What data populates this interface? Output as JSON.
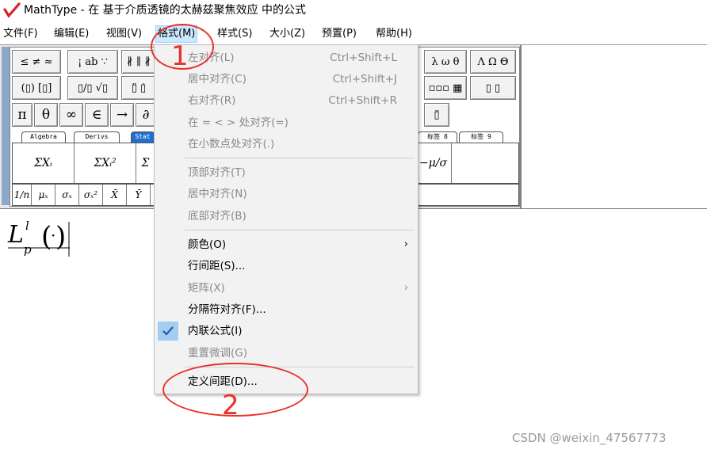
{
  "window": {
    "title": "MathType - 在 基于介质透镜的太赫兹聚焦效应 中的公式"
  },
  "menubar": {
    "items": [
      "文件(F)",
      "编辑(E)",
      "视图(V)",
      "格式(M)",
      "样式(S)",
      "大小(Z)",
      "预置(P)",
      "帮助(H)"
    ],
    "active": "格式(M)"
  },
  "toolbar": {
    "row1": [
      "≤ ≠ ≈",
      "¡ ab ∵",
      "∦ ∥ ∦",
      "λ ω θ",
      "Λ Ω Θ"
    ],
    "row2": [
      "(▯) [▯]",
      "▯/▯ √▯",
      "▯̈ ▯̇",
      "▫▫▫ ▦",
      "▯ ▯"
    ],
    "row3": [
      "π",
      "θ",
      "∞",
      "∈",
      "→",
      "∂",
      "▯̈"
    ],
    "tabs": [
      "Algebra",
      "Derivs",
      "Stat",
      "标签 8",
      "标签 9"
    ],
    "palette": [
      "ΣXᵢ",
      "ΣXᵢ²",
      "Σ",
      "−μ/σ"
    ],
    "small_row": [
      "1/n",
      "μₓ",
      "σₓ",
      "σₓ²",
      "X̄",
      "Ȳ"
    ]
  },
  "equation": {
    "text": "L_p^l(·)"
  },
  "format_menu": {
    "items": [
      {
        "label": "左对齐(L)",
        "shortcut": "Ctrl+Shift+L",
        "enabled": false
      },
      {
        "label": "居中对齐(C)",
        "shortcut": "Ctrl+Shift+J",
        "enabled": false
      },
      {
        "label": "右对齐(R)",
        "shortcut": "Ctrl+Shift+R",
        "enabled": false
      },
      {
        "label": "在 = < > 处对齐(=)",
        "shortcut": "",
        "enabled": false
      },
      {
        "label": "在小数点处对齐(.)",
        "shortcut": "",
        "enabled": false
      },
      {
        "label": "顶部对齐(T)",
        "shortcut": "",
        "enabled": false
      },
      {
        "label": "居中对齐(N)",
        "shortcut": "",
        "enabled": false
      },
      {
        "label": "底部对齐(B)",
        "shortcut": "",
        "enabled": false
      },
      {
        "label": "颜色(O)",
        "shortcut": "",
        "enabled": true,
        "submenu": true
      },
      {
        "label": "行间距(S)...",
        "shortcut": "",
        "enabled": true
      },
      {
        "label": "矩阵(X)",
        "shortcut": "",
        "enabled": false,
        "submenu": true
      },
      {
        "label": "分隔符对齐(F)...",
        "shortcut": "",
        "enabled": true
      },
      {
        "label": "内联公式(I)",
        "shortcut": "",
        "enabled": true,
        "checked": true
      },
      {
        "label": "重置微调(G)",
        "shortcut": "",
        "enabled": false
      },
      {
        "label": "定义间距(D)...",
        "shortcut": "",
        "enabled": true
      }
    ],
    "submenu_arrow": "›",
    "check_mark": "✔"
  },
  "annotations": {
    "step1": "1",
    "step2": "2",
    "color": "#e8322a"
  },
  "watermark": "CSDN @weixin_47567773"
}
